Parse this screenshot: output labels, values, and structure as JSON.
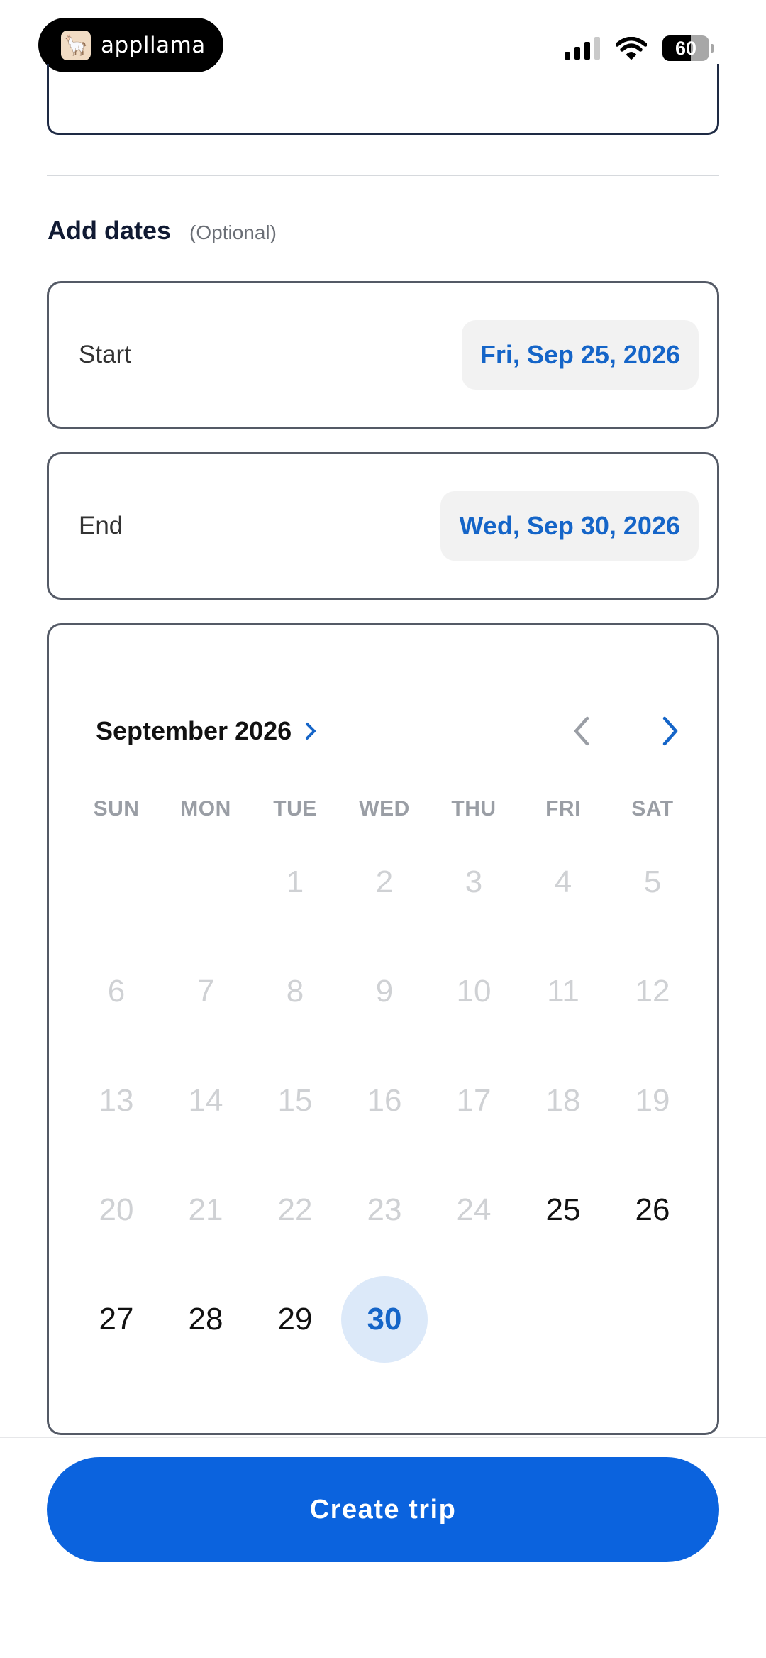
{
  "status_bar": {
    "app_name": "appllama",
    "battery": "60",
    "battery_level": 0.6,
    "icons": [
      "cellular-signal-icon",
      "wifi-icon",
      "battery-icon"
    ]
  },
  "dates_section": {
    "title": "Add dates",
    "optional": "(Optional)",
    "start": {
      "label": "Start",
      "value": "Fri, Sep 25, 2026"
    },
    "end": {
      "label": "End",
      "value": "Wed, Sep 30, 2026"
    }
  },
  "calendar": {
    "month_label": "September 2026",
    "weekdays": [
      "SUN",
      "MON",
      "TUE",
      "WED",
      "THU",
      "FRI",
      "SAT"
    ],
    "weeks": [
      [
        null,
        null,
        {
          "n": "1",
          "s": "disabled"
        },
        {
          "n": "2",
          "s": "disabled"
        },
        {
          "n": "3",
          "s": "disabled"
        },
        {
          "n": "4",
          "s": "disabled"
        },
        {
          "n": "5",
          "s": "disabled"
        }
      ],
      [
        {
          "n": "6",
          "s": "disabled"
        },
        {
          "n": "7",
          "s": "disabled"
        },
        {
          "n": "8",
          "s": "disabled"
        },
        {
          "n": "9",
          "s": "disabled"
        },
        {
          "n": "10",
          "s": "disabled"
        },
        {
          "n": "11",
          "s": "disabled"
        },
        {
          "n": "12",
          "s": "disabled"
        }
      ],
      [
        {
          "n": "13",
          "s": "disabled"
        },
        {
          "n": "14",
          "s": "disabled"
        },
        {
          "n": "15",
          "s": "disabled"
        },
        {
          "n": "16",
          "s": "disabled"
        },
        {
          "n": "17",
          "s": "disabled"
        },
        {
          "n": "18",
          "s": "disabled"
        },
        {
          "n": "19",
          "s": "disabled"
        }
      ],
      [
        {
          "n": "20",
          "s": "disabled"
        },
        {
          "n": "21",
          "s": "disabled"
        },
        {
          "n": "22",
          "s": "disabled"
        },
        {
          "n": "23",
          "s": "disabled"
        },
        {
          "n": "24",
          "s": "disabled"
        },
        {
          "n": "25",
          "s": "enabled"
        },
        {
          "n": "26",
          "s": "enabled"
        }
      ],
      [
        {
          "n": "27",
          "s": "enabled"
        },
        {
          "n": "28",
          "s": "enabled"
        },
        {
          "n": "29",
          "s": "enabled"
        },
        {
          "n": "30",
          "s": "selected"
        },
        null,
        null,
        null
      ]
    ]
  },
  "footer": {
    "create_label": "Create trip"
  },
  "colors": {
    "accent": "#0b63de",
    "accent_text": "#1565c8",
    "selected_bg": "#dce9f9",
    "disabled_text": "#cfd1d4"
  }
}
